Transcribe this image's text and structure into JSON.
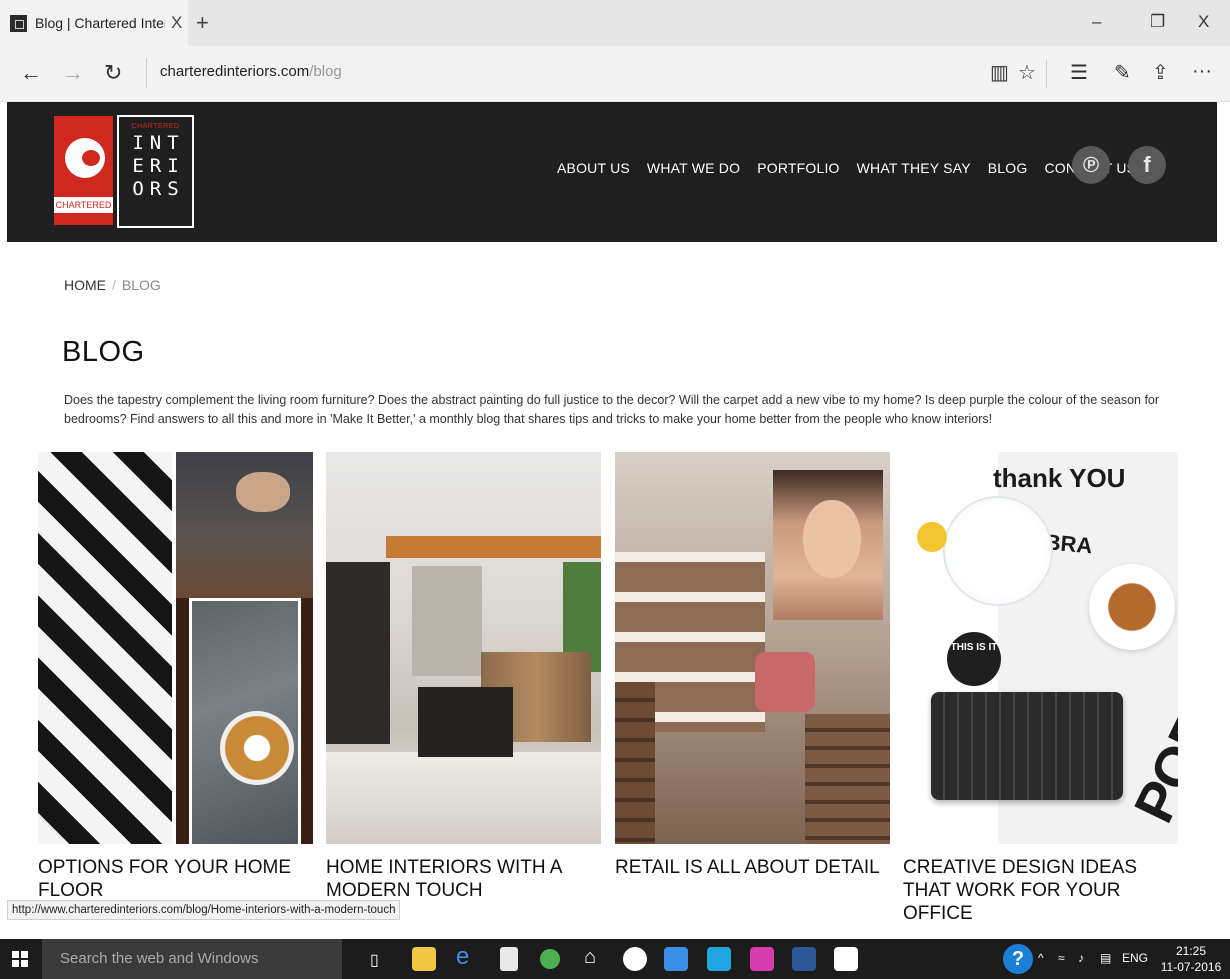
{
  "browser": {
    "tab": {
      "title": "Blog | Chartered Interior",
      "close_glyph": "X"
    },
    "new_tab_glyph": "+",
    "window_controls": {
      "minimize": "–",
      "restore": "❐",
      "close": "X"
    },
    "nav": {
      "back": "←",
      "forward": "→",
      "refresh": "↻"
    },
    "url": {
      "host": "charteredinteriors.com",
      "path": "/blog"
    },
    "toolbar_icons": [
      "reading-view-icon",
      "favorite-star-icon",
      "hub-icon",
      "web-note-icon",
      "share-icon",
      "more-icon"
    ],
    "toolbar_glyphs": {
      "reading": "▥",
      "favorite": "☆",
      "hub": "☰",
      "note": "✎",
      "share": "⇪",
      "more": "···"
    }
  },
  "site": {
    "logo": {
      "top_small": "CHARTERED",
      "lines": [
        "INT",
        "ERI",
        "ORS"
      ],
      "red_label": "CHARTERED"
    },
    "menu": [
      "ABOUT US",
      "WHAT WE DO",
      "PORTFOLIO",
      "WHAT THEY SAY",
      "BLOG",
      "CONTACT US"
    ],
    "social": {
      "pinterest": "℗",
      "facebook": "f"
    }
  },
  "breadcrumb": {
    "home": "HOME",
    "separator": "/",
    "current": "BLOG"
  },
  "page_title": "BLOG",
  "intro": "Does the tapestry complement the living room furniture? Does the abstract painting do full justice to the decor? Will the carpet add a new vibe to my home? Is deep purple the colour of the season for bedrooms? Find answers to all this and more in 'Make It Better,' a monthly blog that shares tips and tricks to make your home better from the people who know interiors!",
  "posts": [
    {
      "title": "OPTIONS FOR YOUR HOME FLOOR"
    },
    {
      "title": "HOME INTERIORS WITH A MODERN TOUCH"
    },
    {
      "title": "RETAIL IS ALL ABOUT DETAIL"
    },
    {
      "title": "CREATIVE DESIGN IDEAS THAT WORK FOR YOUR OFFICE"
    }
  ],
  "thumb_text": {
    "post4_thanks": "thank YOU",
    "post4_word": "YOBRA",
    "post4_big": "PORTANT",
    "post4_badge": "THIS IS IT"
  },
  "status_url": "http://www.charteredinteriors.com/blog/Home-interiors-with-a-modern-touch",
  "taskbar": {
    "search_placeholder": "Search the web and Windows",
    "help_glyph": "?",
    "tray": {
      "chevron": "^",
      "lang": "ENG"
    },
    "clock": {
      "time": "21:25",
      "date": "11-07-2016"
    }
  },
  "colors": {
    "header_bg": "#1f1f1f",
    "brand_red": "#d0281f",
    "taskbar_bg": "#1c1c1c"
  }
}
